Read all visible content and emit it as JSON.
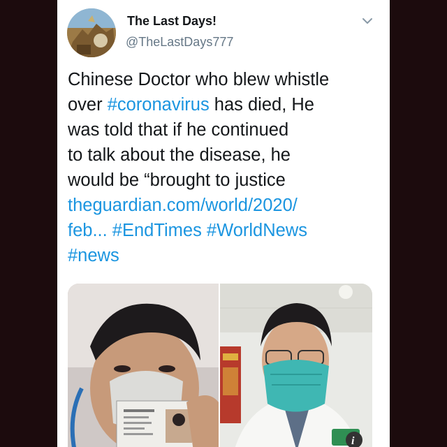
{
  "tweet": {
    "display_name": "The Last Days!",
    "handle": "@TheLastDays777",
    "lines": [
      [
        {
          "text": "Chinese Doctor who blew whistle",
          "link": false
        }
      ],
      [
        {
          "text": "over ",
          "link": false
        },
        {
          "text": "#coronavirus",
          "link": true
        },
        {
          "text": " has died, He",
          "link": false
        }
      ],
      [
        {
          "text": "was told that if he continued",
          "link": false
        }
      ],
      [
        {
          "text": "to talk about the disease, he",
          "link": false
        }
      ],
      [
        {
          "text": "would be “brought to justice",
          "link": false
        }
      ],
      [
        {
          "text": "theguardian.com/world/2020/",
          "link": true
        }
      ],
      [
        {
          "text": "feb...",
          "link": true
        },
        {
          "text": " ",
          "link": false
        },
        {
          "text": "#EndTimes",
          "link": true
        },
        {
          "text": " ",
          "link": false
        },
        {
          "text": "#WorldNews",
          "link": true
        }
      ],
      [
        {
          "text": "#news",
          "link": true
        }
      ]
    ]
  },
  "icons": {
    "chevron": "chevron-down-icon"
  },
  "colors": {
    "link": "#1b95e0",
    "text": "#14171a",
    "secondary": "#657786",
    "frame": "#1c0b0d"
  }
}
